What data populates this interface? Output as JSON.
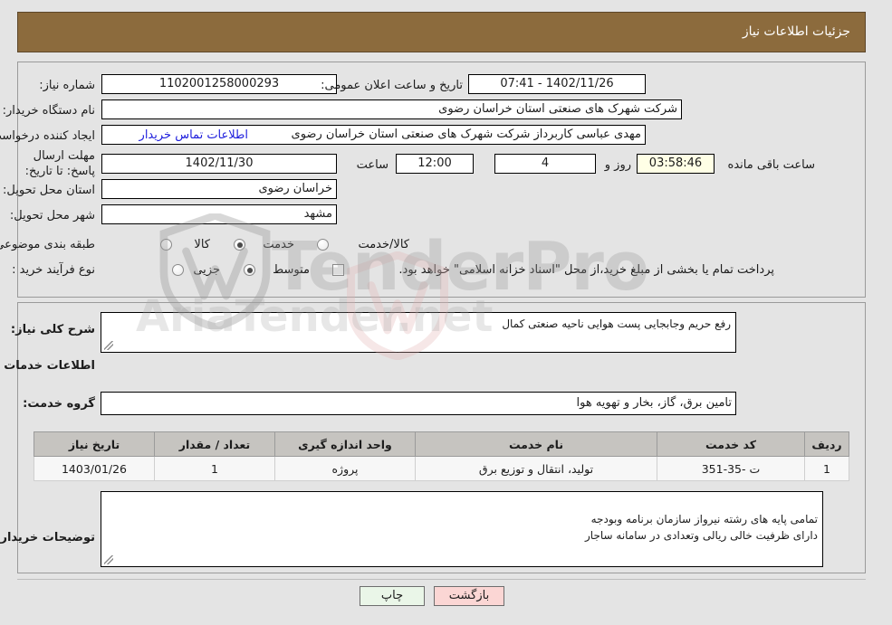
{
  "header": {
    "title": "جزئیات اطلاعات نیاز"
  },
  "top_form": {
    "need_number_label": "شماره نیاز:",
    "need_number_value": "1102001258000293",
    "announce_datetime_label": "تاریخ و ساعت اعلان عمومی:",
    "announce_datetime_value": "1402/11/26 - 07:41",
    "buyer_org_label": "نام دستگاه خریدار:",
    "buyer_org_value": "شرکت شهرک های صنعتی استان خراسان رضوی",
    "creator_label": "ایجاد کننده درخواست:",
    "creator_value": "مهدی عباسی کاربرداز شرکت شهرک های صنعتی استان خراسان رضوی",
    "contact_link": "اطلاعات تماس خریدار",
    "deadline_label": "مهلت ارسال پاسخ: تا تاریخ:",
    "deadline_date": "1402/11/30",
    "hour_label": "ساعت",
    "deadline_time": "12:00",
    "days_value": "4",
    "days_label": "روز و",
    "timer_value": "03:58:46",
    "remaining_label": "ساعت باقی مانده",
    "province_label": "استان محل تحویل:",
    "province_value": "خراسان رضوی",
    "city_label": "شهر محل تحویل:",
    "city_value": "مشهد",
    "category_label": "طبقه بندی موضوعی:",
    "category_options": [
      {
        "label": "کالا",
        "selected": false
      },
      {
        "label": "خدمت",
        "selected": true
      },
      {
        "label": "کالا/خدمت",
        "selected": false
      }
    ],
    "process_label": "نوع فرآیند خرید :",
    "process_options": [
      {
        "label": "جزیی",
        "selected": false
      },
      {
        "label": "متوسط",
        "selected": true
      }
    ],
    "treasury_checkbox_text": "پرداخت تمام یا بخشی از مبلغ خرید،از محل \"اسناد خزانه اسلامی\" خواهد بود.",
    "treasury_checked": false
  },
  "mid_form": {
    "general_desc_label": "شرح کلی نیاز:",
    "general_desc_value": "رفع حریم وجابجایی پست هوایی ناحیه صنعتی کمال",
    "services_info_title": "اطلاعات خدمات مورد نیاز",
    "service_group_label": "گروه خدمت:",
    "service_group_value": "تامین برق، گاز، بخار و تهویه هوا",
    "buyer_notes_label": "توضیحات خریدار:",
    "buyer_notes_value": "تمامی پایه های رشته نیرواز سازمان برنامه وبودجه\nدارای ظرفیت خالی ریالی وتعدادی در سامانه ساجار"
  },
  "table": {
    "columns": [
      "ردیف",
      "کد خدمت",
      "نام خدمت",
      "واحد اندازه گیری",
      "تعداد / مقدار",
      "تاریخ نیاز"
    ],
    "rows": [
      {
        "row": "1",
        "service_code": "ت -35-351",
        "service_name": "تولید، انتقال و توزیع برق",
        "unit": "پروژه",
        "quantity": "1",
        "need_date": "1403/01/26"
      }
    ]
  },
  "footer": {
    "print_label": "چاپ",
    "back_label": "بازگشت"
  },
  "watermark": {
    "text": "TenderPro",
    "text2": "AriaTender.net"
  },
  "colors": {
    "header_bg": "#8c6b3d",
    "page_bg": "#e4e4e4",
    "link": "#2020dd",
    "timer_bg": "#ffffe6",
    "print_btn_bg": "#eaf6e8",
    "back_btn_bg": "#fbd6d4",
    "table_header_bg": "#c6c4c0"
  }
}
